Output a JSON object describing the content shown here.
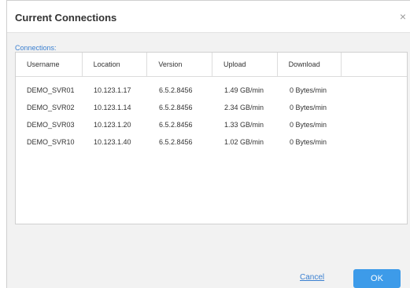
{
  "dialog": {
    "title": "Current Connections",
    "close_label": "×"
  },
  "section": {
    "label": "Connections:"
  },
  "table": {
    "columns": [
      "Username",
      "Location",
      "Version",
      "Upload",
      "Download",
      ""
    ],
    "rows": [
      [
        "DEMO_SVR01",
        "10.123.1.17",
        "6.5.2.8456",
        "1.49 GB/min",
        "0 Bytes/min"
      ],
      [
        "DEMO_SVR02",
        "10.123.1.14",
        "6.5.2.8456",
        "2.34 GB/min",
        "0 Bytes/min"
      ],
      [
        "DEMO_SVR03",
        "10.123.1.20",
        "6.5.2.8456",
        "1.33 GB/min",
        "0 Bytes/min"
      ],
      [
        "DEMO_SVR10",
        "10.123.1.40",
        "6.5.2.8456",
        "1.02 GB/min",
        "0 Bytes/min"
      ]
    ]
  },
  "footer": {
    "cancel_label": "Cancel",
    "ok_label": "OK"
  },
  "colors": {
    "accent": "#3a7fd0",
    "ok_button": "#3d9be9",
    "background": "#f2f2f2"
  }
}
